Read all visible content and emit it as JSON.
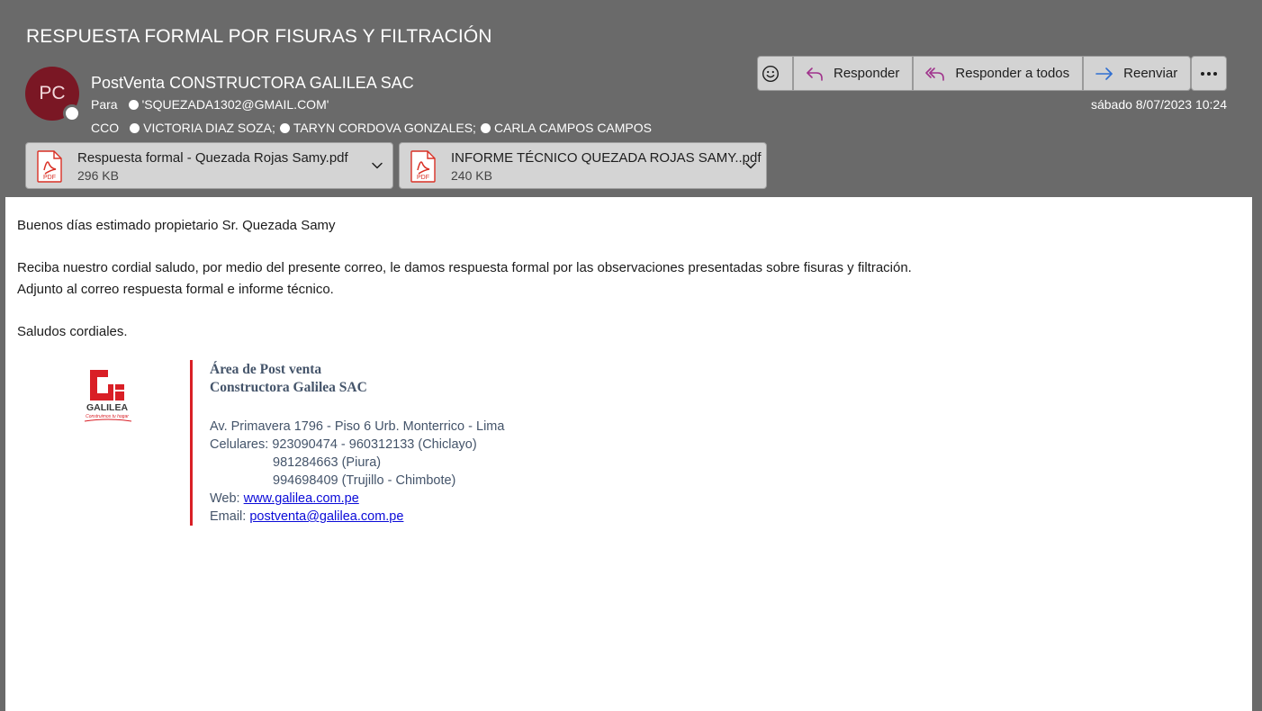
{
  "email": {
    "subject": "RESPUESTA FORMAL POR FISURAS Y FILTRACIÓN",
    "avatar_initials": "PC",
    "avatar_color": "#7a1724",
    "sender": "PostVenta CONSTRUCTORA GALILEA SAC",
    "to_label": "Para",
    "to": [
      "'SQUEZADA1302@GMAIL.COM'"
    ],
    "cco_label": "CCO",
    "cco": [
      "VICTORIA DIAZ SOZA;",
      "TARYN CORDOVA GONZALES;",
      "CARLA CAMPOS CAMPOS"
    ],
    "date": "sábado 8/07/2023 10:24"
  },
  "actions": {
    "emoji_icon": "smiley-icon",
    "reply": "Responder",
    "reply_all": "Responder a todos",
    "forward": "Reenviar",
    "more_icon": "more-ellipsis-icon"
  },
  "attachments": [
    {
      "name": "Respuesta formal - Quezada Rojas Samy.pdf",
      "size": "296 KB",
      "icon": "pdf-icon"
    },
    {
      "name": "INFORME TÉCNICO QUEZADA ROJAS SAMY..pdf",
      "size": "240 KB",
      "icon": "pdf-icon"
    }
  ],
  "body": {
    "greeting": "Buenos días estimado propietario Sr. Quezada Samy",
    "line1": "Reciba nuestro cordial saludo, por medio del presente correo, le damos respuesta formal por las observaciones presentadas sobre fisuras y filtración.",
    "line2": "Adjunto al correo respuesta formal e informe técnico.",
    "closing": "Saludos cordiales."
  },
  "signature": {
    "logo_name": "GALILEA",
    "logo_tagline": "Construimos tu hogar",
    "brand_color": "#d91f26",
    "dept": "Área de Post venta",
    "company": "Constructora Galilea SAC",
    "address": "Av. Primavera 1796 - Piso 6 Urb. Monterrico - Lima",
    "phones_label": "Celulares:",
    "phones": [
      "923090474 - 960312133 (Chiclayo)",
      "981284663 (Piura)",
      "994698409 (Trujillo - Chimbote)"
    ],
    "web_label": "Web:",
    "web": "www.galilea.com.pe",
    "email_label": "Email:",
    "email": "postventa@galilea.com.pe"
  }
}
